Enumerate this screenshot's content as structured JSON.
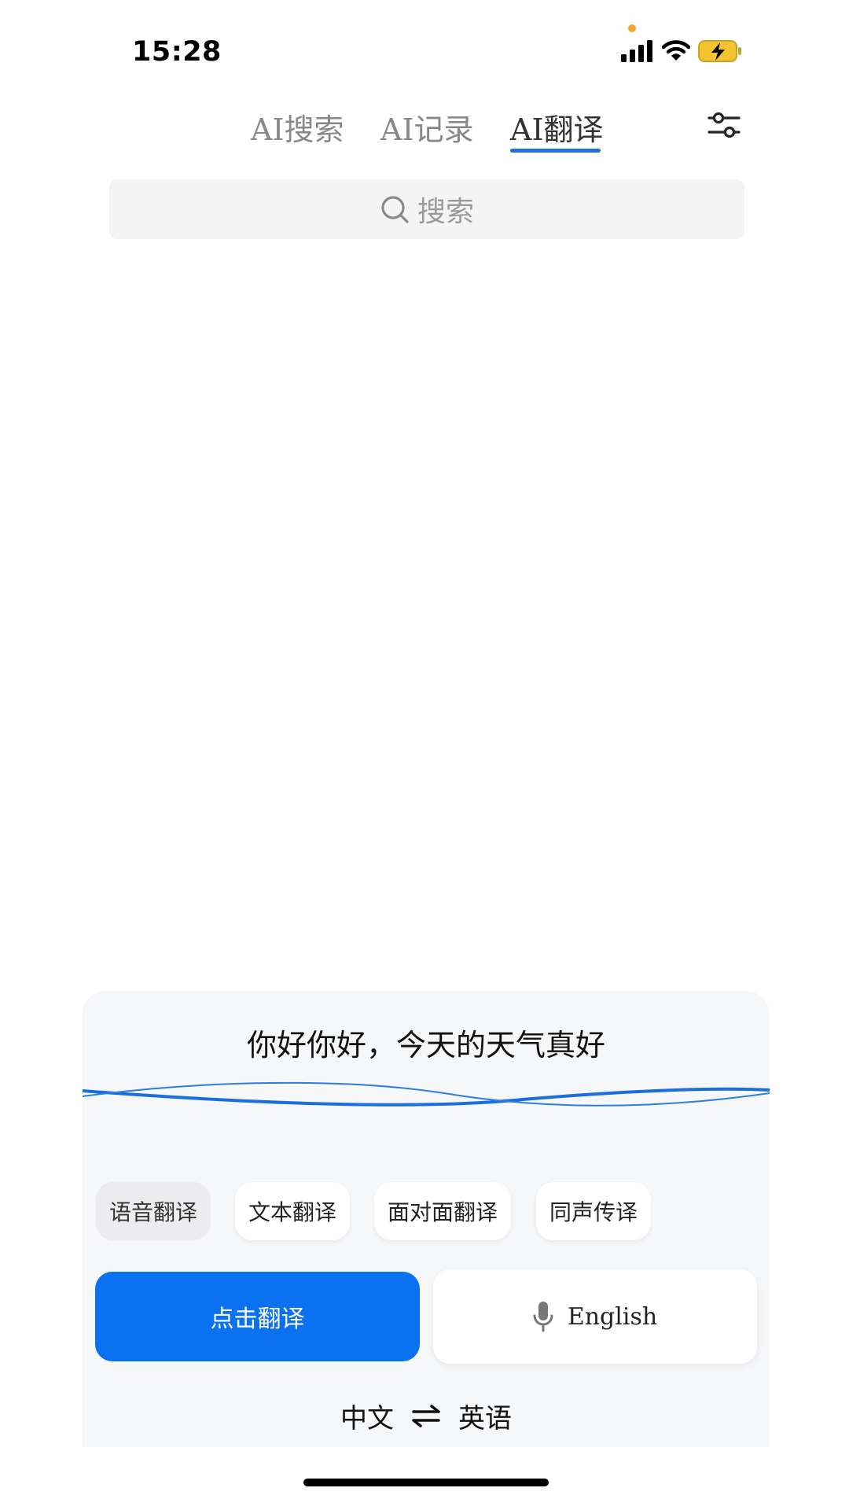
{
  "status_bar": {
    "time": "15:28",
    "icons": [
      "signal-icon",
      "wifi-icon",
      "battery-charging-icon"
    ],
    "battery_color": "#f4c430",
    "privacy_dot_color": "#f4a732"
  },
  "tabs": [
    {
      "label": "AI搜索",
      "active": false
    },
    {
      "label": "AI记录",
      "active": false
    },
    {
      "label": "AI翻译",
      "active": true
    }
  ],
  "accent_color": "#0a72f0",
  "search": {
    "placeholder": "搜索",
    "icon": "search-icon"
  },
  "translator": {
    "transcript": "你好你好，今天的天气真好",
    "modes": [
      {
        "label": "语音翻译",
        "active": true
      },
      {
        "label": "文本翻译",
        "active": false
      },
      {
        "label": "面对面翻译",
        "active": false
      },
      {
        "label": "同声传译",
        "active": false
      }
    ],
    "primary_button": "点击翻译",
    "voice_button": {
      "icon": "microphone-icon",
      "language": "English"
    },
    "source_language": "中文",
    "target_language": "英语",
    "swap_icon": "swap-arrows-icon"
  }
}
